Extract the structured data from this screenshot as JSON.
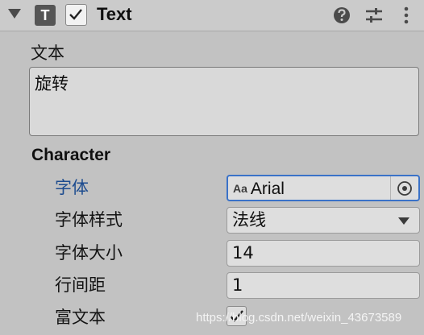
{
  "component": {
    "icon_letter": "T",
    "enabled": true,
    "title": "Text",
    "icons": [
      "collapse-arrow-icon",
      "text-component-icon",
      "checkbox-checked-icon",
      "help-icon",
      "presets-icon",
      "kebab-menu-icon"
    ]
  },
  "text": {
    "label": "文本",
    "value": "旋转"
  },
  "character": {
    "header": "Character",
    "font": {
      "label": "字体",
      "icon_text": "Aa",
      "value": "Arial"
    },
    "font_style": {
      "label": "字体样式",
      "value": "法线"
    },
    "font_size": {
      "label": "字体大小",
      "value": "14"
    },
    "line_spacing": {
      "label": "行间距",
      "value": "1"
    },
    "rich_text": {
      "label": "富文本",
      "checked": true
    }
  },
  "watermark": "https://blog.csdn.net/weixin_43673589",
  "colors": {
    "panel_bg": "#c2c2c2",
    "active_label": "#1d4c8f",
    "focus_border": "#3a72c8"
  }
}
